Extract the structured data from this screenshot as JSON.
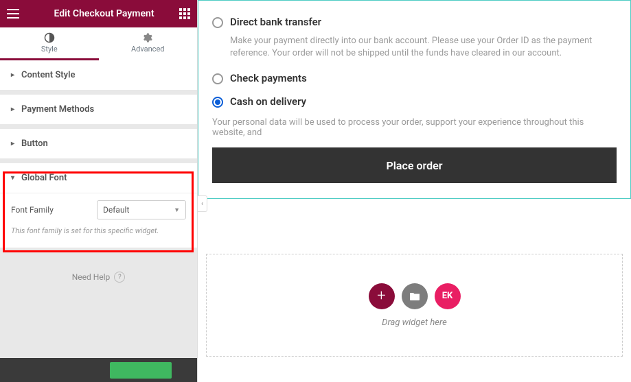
{
  "header": {
    "title": "Edit Checkout Payment"
  },
  "tabs": {
    "style": "Style",
    "advanced": "Advanced"
  },
  "sections": {
    "content_style": "Content Style",
    "payment_methods": "Payment Methods",
    "button": "Button",
    "global_font": "Global Font"
  },
  "global_font": {
    "label": "Font Family",
    "value": "Default",
    "help": "This font family is set for this specific widget."
  },
  "need_help": "Need Help",
  "payment": {
    "opt1": "Direct bank transfer",
    "opt1_desc": "Make your payment directly into our bank account. Please use your Order ID as the payment reference. Your order will not be shipped until the funds have cleared in our account.",
    "opt2": "Check payments",
    "opt3": "Cash on delivery",
    "privacy": "Your personal data will be used to process your order, support your experience throughout this website, and",
    "place": "Place order"
  },
  "drop": {
    "hint": "Drag widget here",
    "ek": "EK"
  }
}
